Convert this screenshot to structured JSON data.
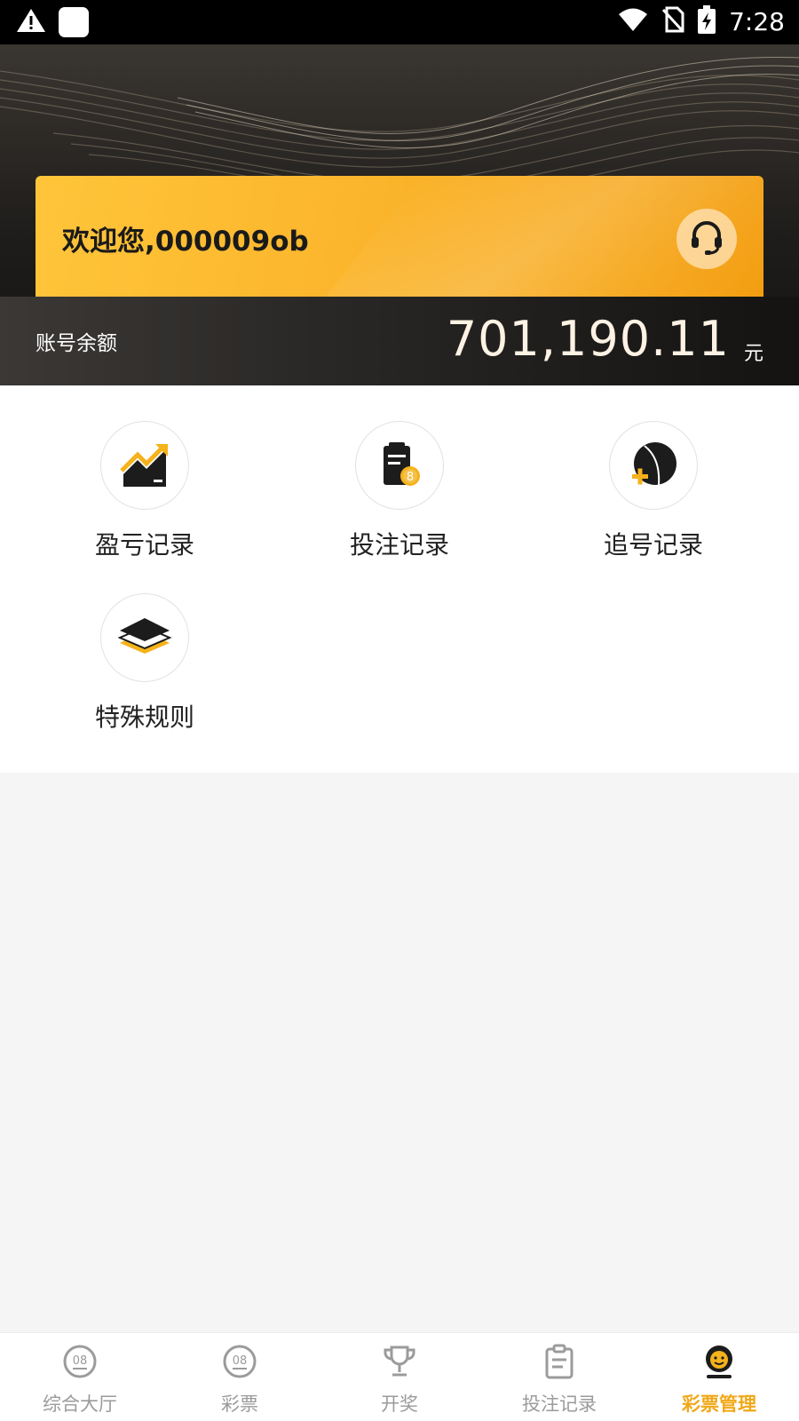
{
  "status_bar": {
    "time": "7:28",
    "icons": [
      "warning-icon",
      "app-square-icon",
      "wifi-icon",
      "no-sim-icon",
      "battery-charging-icon"
    ]
  },
  "header": {
    "welcome": "欢迎您,000009ob",
    "support_icon": "headset-icon",
    "balance_label": "账号余额",
    "balance_amount": "701,190.11",
    "balance_unit": "元"
  },
  "menu": {
    "items": [
      {
        "label": "盈亏记录",
        "icon": "profit-chart-icon"
      },
      {
        "label": "投注记录",
        "icon": "bet-clipboard-icon"
      },
      {
        "label": "追号记录",
        "icon": "chase-ball-icon"
      },
      {
        "label": "特殊规则",
        "icon": "layers-icon"
      }
    ]
  },
  "bottom_nav": {
    "items": [
      {
        "label": "综合大厅",
        "icon": "lobby-ball-icon",
        "active": false
      },
      {
        "label": "彩票",
        "icon": "lottery-ball-icon",
        "active": false
      },
      {
        "label": "开奖",
        "icon": "trophy-icon",
        "active": false
      },
      {
        "label": "投注记录",
        "icon": "clipboard-icon",
        "active": false
      },
      {
        "label": "彩票管理",
        "icon": "profile-icon",
        "active": true
      }
    ]
  },
  "colors": {
    "accent": "#f0a818",
    "card_gradient_start": "#ffc53a",
    "card_gradient_end": "#f39d0e",
    "header_dark": "#1f1d1b",
    "inactive_nav": "#9b9b9b"
  }
}
